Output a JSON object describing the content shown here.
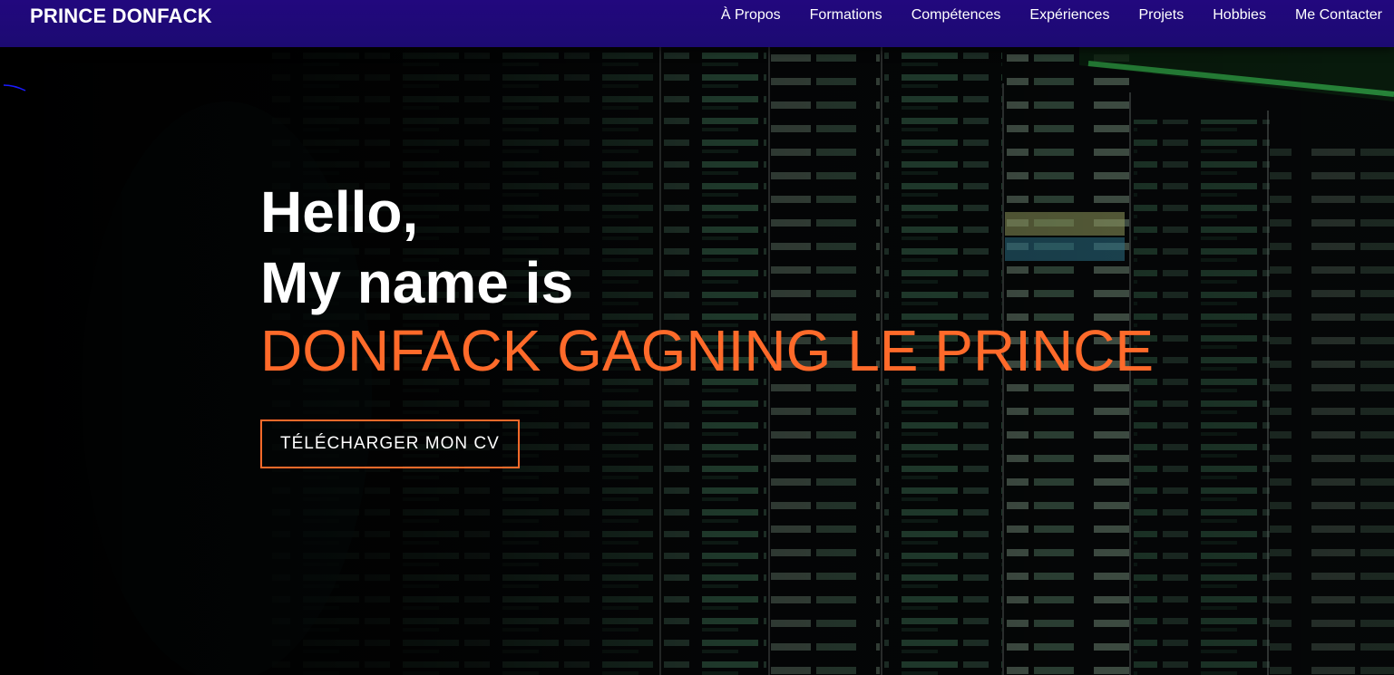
{
  "navbar": {
    "brand": "PRINCE DONFACK",
    "links": [
      "À Propos",
      "Formations",
      "Compétences",
      "Expériences",
      "Projets",
      "Hobbies",
      "Me Contacter"
    ]
  },
  "hero": {
    "greeting_line1": "Hello,",
    "greeting_line2": "My name is",
    "name": "DONFACK GAGNING LE PRINCE",
    "cv_button": "TÉLÉCHARGER MON CV"
  },
  "colors": {
    "navbar_bg": "#22087e",
    "accent": "#ff6a2a",
    "text": "#ffffff"
  }
}
